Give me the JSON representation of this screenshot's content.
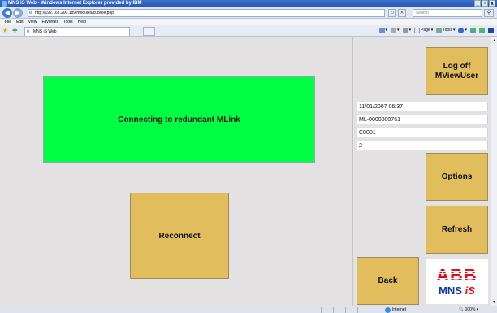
{
  "window": {
    "title": "MNS iS Web - Windows Internet Explorer provided by IBM",
    "controls": [
      "_",
      "▫",
      "x"
    ]
  },
  "address": {
    "url": "http://192.168.200.189/modules/cubicle.php",
    "search_placeholder": "Search"
  },
  "menu": [
    "File",
    "Edit",
    "View",
    "Favorites",
    "Tools",
    "Help"
  ],
  "tab": {
    "label": "MNS iS Web"
  },
  "toolbar": {
    "page": "Page",
    "tools": "Tools"
  },
  "main": {
    "status_message": "Connecting to redundant MLink",
    "reconnect_label": "Reconnect"
  },
  "panel": {
    "logoff_line1": "Log off",
    "logoff_line2": "MViewUser",
    "datetime": "11/01/2007 06:37",
    "mlink_id": "ML-0000000761",
    "cubicle": "C0001",
    "number": "2",
    "options_label": "Options",
    "refresh_label": "Refresh",
    "back_label": "Back",
    "logo_brand": "ABB",
    "logo_product": "MNS",
    "logo_suffix": "iS"
  },
  "status": {
    "zone": "Internet",
    "zoom": "100%"
  },
  "colors": {
    "banner": "#00ff44",
    "button": "#e2bd5d",
    "brand_red": "#e30613",
    "brand_blue": "#0b3c9e"
  }
}
